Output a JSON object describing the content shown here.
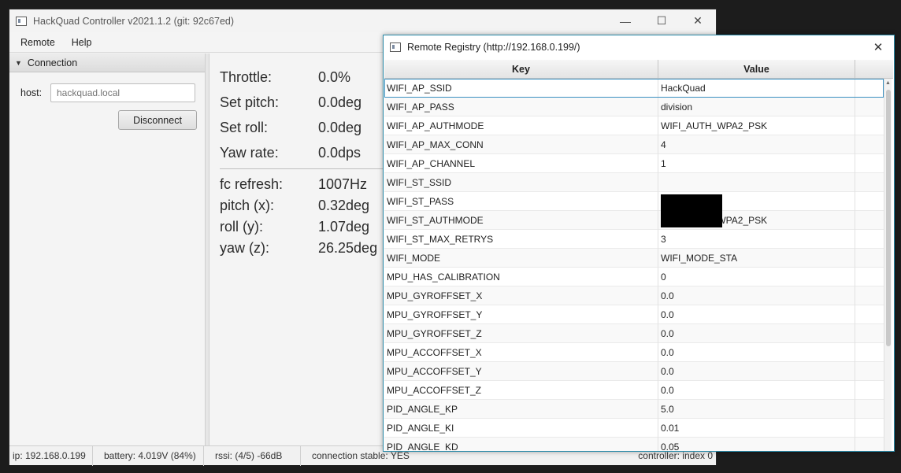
{
  "main_window": {
    "title": "HackQuad Controller v2021.1.2 (git: 92c67ed)",
    "controls": {
      "minimize": "—",
      "maximize": "☐",
      "close": "✕"
    },
    "menu": [
      "Remote",
      "Help"
    ]
  },
  "connection": {
    "header": "Connection",
    "host_label": "host:",
    "host_placeholder": "hackquad.local",
    "disconnect_label": "Disconnect"
  },
  "telemetry": {
    "setpoints": [
      {
        "label": "Throttle:",
        "value": "0.0%"
      },
      {
        "label": "Set pitch:",
        "value": "0.0deg"
      },
      {
        "label": "Set roll:",
        "value": "0.0deg"
      },
      {
        "label": "Yaw rate:",
        "value": "0.0dps"
      }
    ],
    "sensors": [
      {
        "label": "fc refresh:",
        "value": "1007Hz"
      },
      {
        "label": "pitch (x):",
        "value": "0.32deg"
      },
      {
        "label": "roll (y):",
        "value": "1.07deg"
      },
      {
        "label": "yaw (z):",
        "value": "26.25deg"
      }
    ]
  },
  "statusbar": {
    "ip": "ip:  192.168.0.199",
    "battery": "battery:  4.019V (84%)",
    "rssi": "rssi:  (4/5) -66dB",
    "connection": "connection stable:  YES",
    "controller": "controller:  index 0"
  },
  "registry": {
    "title": "Remote Registry (http://192.168.0.199/)",
    "close": "✕",
    "columns": {
      "key": "Key",
      "value": "Value"
    },
    "rows": [
      {
        "key": "WIFI_AP_SSID",
        "value": "HackQuad"
      },
      {
        "key": "WIFI_AP_PASS",
        "value": "division"
      },
      {
        "key": "WIFI_AP_AUTHMODE",
        "value": "WIFI_AUTH_WPA2_PSK"
      },
      {
        "key": "WIFI_AP_MAX_CONN",
        "value": "4"
      },
      {
        "key": "WIFI_AP_CHANNEL",
        "value": "1"
      },
      {
        "key": "WIFI_ST_SSID",
        "value": ""
      },
      {
        "key": "WIFI_ST_PASS",
        "value": ""
      },
      {
        "key": "WIFI_ST_AUTHMODE",
        "value": "WIFI_AUTH_WPA2_PSK"
      },
      {
        "key": "WIFI_ST_MAX_RETRYS",
        "value": "3"
      },
      {
        "key": "WIFI_MODE",
        "value": "WIFI_MODE_STA"
      },
      {
        "key": "MPU_HAS_CALIBRATION",
        "value": "0"
      },
      {
        "key": "MPU_GYROFFSET_X",
        "value": "0.0"
      },
      {
        "key": "MPU_GYROFFSET_Y",
        "value": "0.0"
      },
      {
        "key": "MPU_GYROFFSET_Z",
        "value": "0.0"
      },
      {
        "key": "MPU_ACCOFFSET_X",
        "value": "0.0"
      },
      {
        "key": "MPU_ACCOFFSET_Y",
        "value": "0.0"
      },
      {
        "key": "MPU_ACCOFFSET_Z",
        "value": "0.0"
      },
      {
        "key": "PID_ANGLE_KP",
        "value": "5.0"
      },
      {
        "key": "PID_ANGLE_KI",
        "value": "0.01"
      },
      {
        "key": "PID_ANGLE_KD",
        "value": "0.05"
      }
    ]
  }
}
